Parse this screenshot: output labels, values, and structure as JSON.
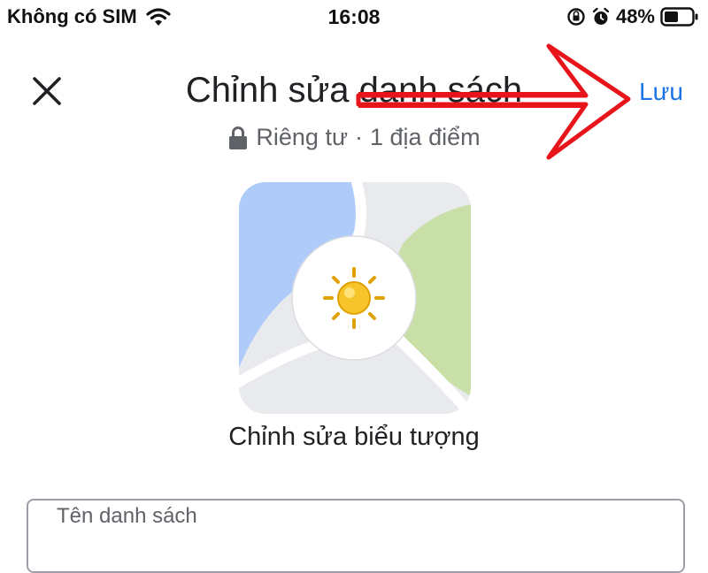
{
  "status_bar": {
    "carrier": "Không có SIM",
    "time": "16:08",
    "battery": "48%"
  },
  "header": {
    "title": "Chỉnh sửa danh sách",
    "save_label": "Lưu",
    "privacy": "Riêng tư",
    "separator": "·",
    "place_count": "1 địa điểm"
  },
  "icon_section": {
    "edit_label": "Chỉnh sửa biểu tượng",
    "emoji": "sun"
  },
  "form": {
    "name_label": "Tên danh sách"
  },
  "colors": {
    "accent": "#1a73e8",
    "annotation_arrow": "#e8141b",
    "map_water": "#aecbfa",
    "map_park": "#c8dfa8"
  },
  "icons": [
    "close-icon",
    "wifi-icon",
    "lock-icon",
    "alarm-icon",
    "orientation-lock-icon",
    "battery-icon",
    "sun-icon"
  ]
}
